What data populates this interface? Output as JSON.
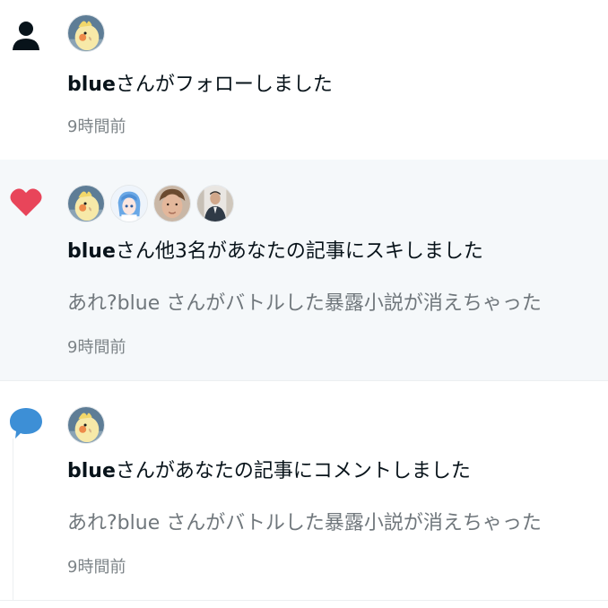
{
  "notifications": [
    {
      "type": "follow",
      "type_icon": "person-icon",
      "avatars": [
        "cockatiel-avatar"
      ],
      "actor": "blue",
      "action_text": "さんがフォローしました",
      "excerpt": "",
      "time": "9時間前"
    },
    {
      "type": "like",
      "type_icon": "heart-icon",
      "avatars": [
        "cockatiel-avatar",
        "anime-avatar",
        "man-face-avatar",
        "man-photo-avatar"
      ],
      "actor": "blue",
      "action_text": "さん他3名があなたの記事にスキしました",
      "excerpt": "あれ?blue さんがバトルした暴露小説が消えちゃった",
      "time": "9時間前"
    },
    {
      "type": "comment",
      "type_icon": "comment-bubble-icon",
      "avatars": [
        "cockatiel-avatar"
      ],
      "actor": "blue",
      "action_text": "さんがあなたの記事にコメントしました",
      "excerpt": "あれ?blue さんがバトルした暴露小説が消えちゃった",
      "time": "9時間前"
    }
  ],
  "colors": {
    "like_heart": "#e8455a",
    "comment_bubble": "#3d8fd6",
    "highlight_bg": "#f5f8fa",
    "secondary_text": "#70777c"
  }
}
